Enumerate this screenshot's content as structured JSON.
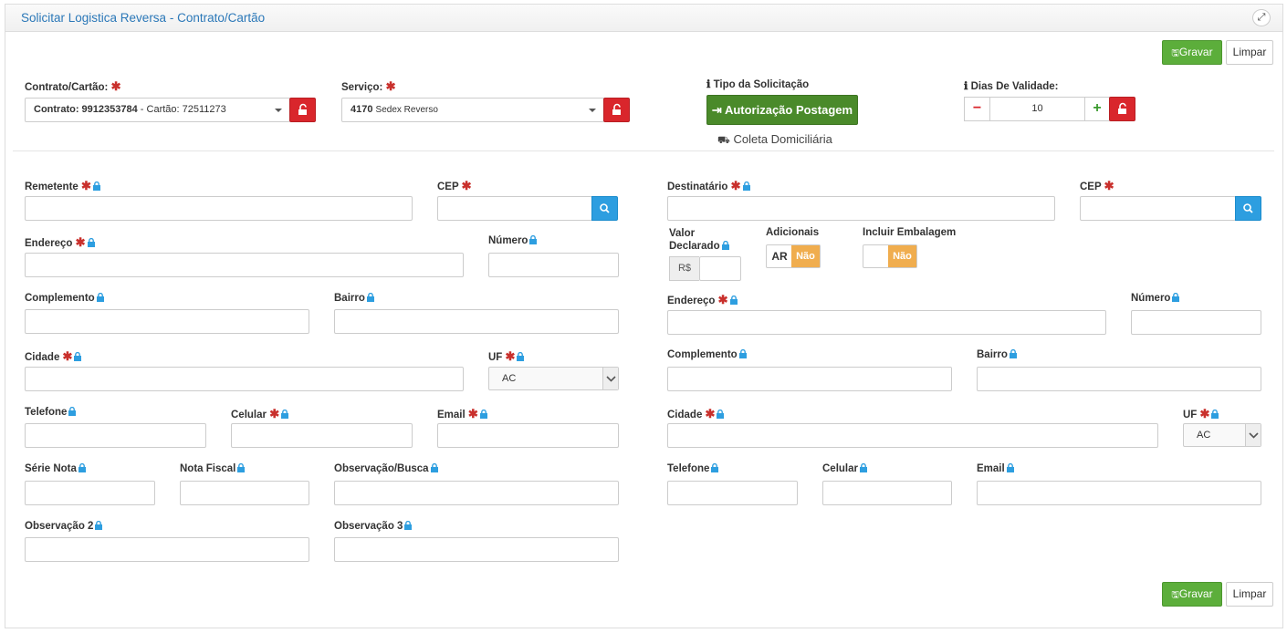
{
  "page": {
    "title": "Solicitar Logistica Reversa - Contrato/Cartão"
  },
  "buttons": {
    "save": "Gravar",
    "clear": "Limpar"
  },
  "top": {
    "contrato_label": "Contrato/Cartão:",
    "contrato_value_bold": "Contrato: 9912353784",
    "contrato_value_rest": "- Cartão: 72511273",
    "servico_label": "Serviço:",
    "servico_value_bold": "4170",
    "servico_value_rest": "Sedex Reverso",
    "tipo_label": "Tipo da Solicitação",
    "tipo_active": "Autorização Postagem",
    "tipo_other": "Coleta Domiciliária",
    "dias_label": "Dias De Validade:",
    "dias_value": "10"
  },
  "remetente": {
    "remetente": "Remetente",
    "cep": "CEP",
    "endereco": "Endereço",
    "numero": "Número",
    "complemento": "Complemento",
    "bairro": "Bairro",
    "cidade": "Cidade",
    "uf": "UF",
    "uf_value": "AC",
    "telefone": "Telefone",
    "celular": "Celular",
    "email": "Email",
    "serie_nota": "Série Nota",
    "nota_fiscal": "Nota Fiscal",
    "observacao_busca": "Observação/Busca",
    "observacao2": "Observação 2",
    "observacao3": "Observação 3"
  },
  "destinatario": {
    "destinatario": "Destinatário",
    "cep": "CEP",
    "valor_declarado_1": "Valor",
    "valor_declarado_2": "Declarado",
    "currency": "R$",
    "adicionais": "Adicionais",
    "ar": "AR",
    "nao": "Não",
    "incluir_embalagem": "Incluir Embalagem",
    "endereco": "Endereço",
    "numero": "Número",
    "complemento": "Complemento",
    "bairro": "Bairro",
    "cidade": "Cidade",
    "uf": "UF",
    "uf_value": "AC",
    "telefone": "Telefone",
    "celular": "Celular",
    "email": "Email"
  },
  "colors": {
    "accent": "#2b78b8",
    "green": "#5cae3b",
    "dark_green": "#4a8a2a",
    "red": "#d9262c",
    "blue": "#2d9ee0",
    "orange": "#f0ad4e"
  }
}
